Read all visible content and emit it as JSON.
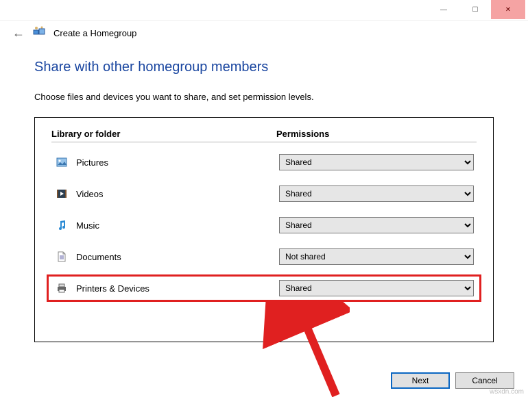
{
  "titlebar": {
    "min": "—",
    "max": "☐",
    "close": "✕"
  },
  "crumb": {
    "title": "Create a Homegroup"
  },
  "heading": "Share with other homegroup members",
  "subtext": "Choose files and devices you want to share, and set permission levels.",
  "columns": {
    "library": "Library or folder",
    "permissions": "Permissions"
  },
  "rows": [
    {
      "label": "Pictures",
      "value": "Shared"
    },
    {
      "label": "Videos",
      "value": "Shared"
    },
    {
      "label": "Music",
      "value": "Shared"
    },
    {
      "label": "Documents",
      "value": "Not shared"
    },
    {
      "label": "Printers & Devices",
      "value": "Shared"
    }
  ],
  "options": [
    "Shared",
    "Not shared"
  ],
  "footer": {
    "next": "Next",
    "cancel": "Cancel"
  },
  "watermark": "wsxdn.com"
}
